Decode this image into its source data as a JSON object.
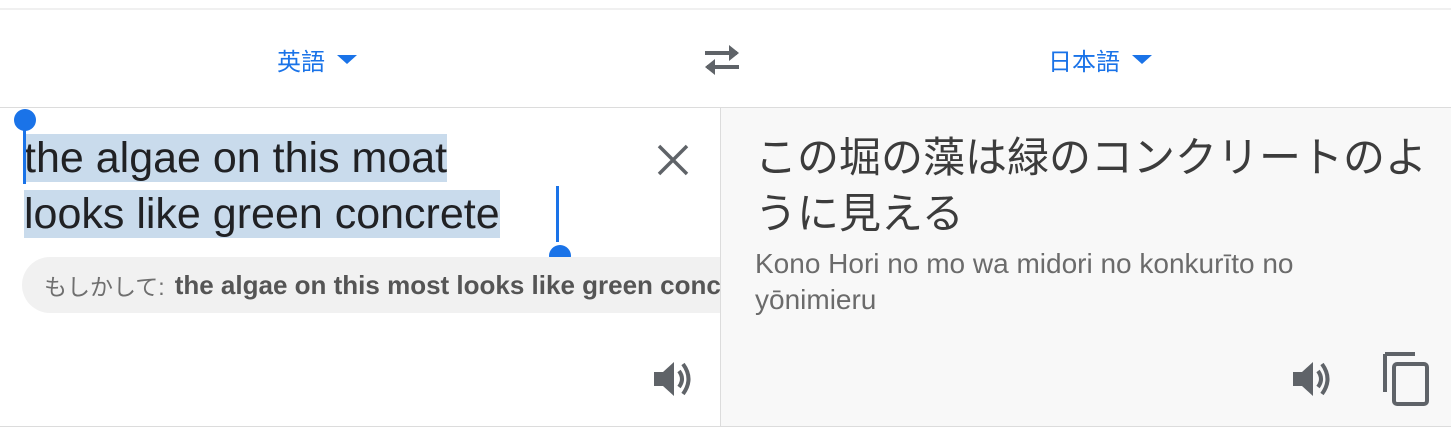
{
  "languages": {
    "source": "英語",
    "target": "日本語"
  },
  "source": {
    "line1": "the algae on this moat",
    "line2": "looks like green concrete",
    "suggestion_prefix": "もしかして:",
    "suggestion_text": "the algae on this most looks like green concrete"
  },
  "target": {
    "translation": "この堀の藻は緑のコンクリートのように見える",
    "romanization": "Kono Hori no mo wa midori no konkurīto no yōnimieru"
  },
  "colors": {
    "accent": "#1a73e8",
    "selection": "#c9dbec",
    "icon": "#5f6368"
  },
  "icons": {
    "dropdown": "caret-down-icon",
    "swap": "swap-arrows-icon",
    "clear": "close-icon",
    "speaker": "speaker-icon",
    "copy": "copy-icon"
  }
}
